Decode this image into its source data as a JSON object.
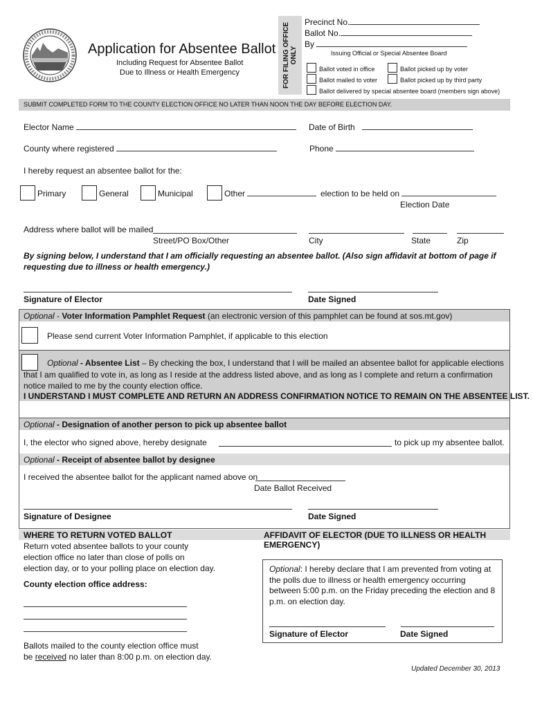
{
  "header": {
    "seal_label": "The Great Seal of the State of Montana",
    "title": "Application for Absentee Ballot",
    "subtitle_line1": "Including Request for Absentee Ballot",
    "subtitle_line2": "Due to Illness or Health Emergency"
  },
  "filing_office": {
    "side_label_1": "FOR FILING OFFICE",
    "side_label_2": "ONLY",
    "precinct_label": "Precinct No.",
    "ballot_label": "Ballot No.",
    "by_label": "By",
    "by_caption": "Issuing Official or Special Absentee Board",
    "checkboxes": [
      "Ballot voted in office",
      "Ballot picked up by voter",
      "Ballot mailed to voter",
      "Ballot picked up by third party",
      "Ballot delivered by special absentee board (members sign above)"
    ]
  },
  "notice": "SUBMIT COMPLETED FORM TO THE COUNTY ELECTION OFFICE NO LATER THAN NOON THE DAY BEFORE ELECTION DAY.",
  "elector": {
    "name_label": "Elector Name",
    "dob_label": "Date of Birth",
    "county_label": "County where registered",
    "phone_label": "Phone",
    "request_label": "I hereby request an absentee ballot for the:",
    "election_types": [
      "Primary",
      "General",
      "Municipal",
      "Other"
    ],
    "held_on_label": "election to be held on",
    "election_date_caption": "Election Date",
    "address_label": "Address where ballot will be mailed",
    "address_captions": [
      "Street/PO Box/Other",
      "City",
      "State",
      "Zip"
    ],
    "statement": "By signing below, I understand that I am officially requesting an absentee ballot.  (Also sign affidavit at bottom of page if requesting due to illness or health emergency.)",
    "signature_label": "Signature of Elector",
    "date_signed_label": "Date Signed"
  },
  "pamphlet": {
    "optional": "Optional",
    "sep": " - ",
    "title": "Voter Information Pamphlet Request",
    "note": " (an electronic version of this pamphlet can be found at sos.mt.gov)",
    "checkbox_label": "Please send current Voter Information Pamphlet, if applicable to this election"
  },
  "absentee_list": {
    "optional": "Optional",
    "title": " - Absentee List",
    "dash": " – ",
    "text": "By checking the box, I understand that I will be mailed an absentee ballot for applicable elections that I am qualified to vote in, as long as I reside at the address listed above, and as long as I complete and return a confirmation notice mailed to me by the county election office.",
    "warning": "I UNDERSTAND I MUST COMPLETE AND RETURN AN ADDRESS CONFIRMATION NOTICE TO REMAIN ON THE ABSENTEE LIST."
  },
  "designation": {
    "optional": "Optional",
    "title": " - Designation of another person to pick up absentee ballot",
    "text_before": "I, the elector who signed above, hereby designate",
    "text_after": "to pick up my absentee ballot."
  },
  "receipt": {
    "optional": "Optional",
    "title": " - Receipt of absentee ballot by designee",
    "text": "I received the absentee ballot for the applicant named above on",
    "date_caption": "Date Ballot Received",
    "signature_label": "Signature of Designee",
    "date_signed_label": "Date Signed"
  },
  "return": {
    "header": "WHERE TO RETURN VOTED BALLOT",
    "line1": "Return voted absentee ballots to your county",
    "line2": "election office no later than close of polls on",
    "line3": "election day, or to your polling place on election day.",
    "address_label": "County election office address:",
    "mail_line1": "Ballots mailed to the county election office must",
    "mail_be": "be ",
    "mail_received": "received",
    "mail_rest": " no later than 8:00 p.m. on election day."
  },
  "affidavit": {
    "header": "AFFIDAVIT OF ELECTOR (DUE TO ILLNESS OR HEALTH EMERGENCY)",
    "optional": "Optional",
    "text": ": I hereby declare that I am prevented from voting at the polls due to illness or health emergency occurring between 5:00 p.m. on the Friday preceding the election and 8 p.m. on election day.",
    "signature_label": "Signature of Elector",
    "date_signed_label": "Date Signed"
  },
  "footer": {
    "updated": "Updated December 30, 2013"
  }
}
